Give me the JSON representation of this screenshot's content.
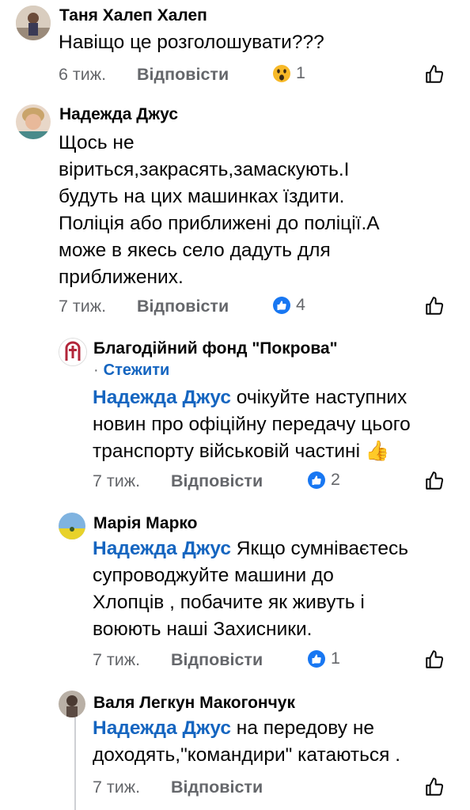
{
  "comments": [
    {
      "author": "Таня Халеп Халеп",
      "text": "Навіщо  це розголошувати???",
      "time": "6 тиж.",
      "reply_label": "Відповісти",
      "reaction_icon": "wow-icon",
      "reaction_count": "1"
    },
    {
      "author": "Надежда Джус",
      "text_lines": [
        "Щось не",
        "віриться,закрасять,замаскують.І",
        "будуть на цих машинках їздити.",
        "Поліція або приближені до поліції.А",
        "може в якесь село дадуть для",
        "приближених."
      ],
      "time": "7 тиж.",
      "reply_label": "Відповісти",
      "reaction_icon": "like-icon",
      "reaction_count": "4"
    }
  ],
  "replies": [
    {
      "author": "Благодійний фонд \"Покрова\"",
      "follow_label": "Стежити",
      "mention": "Надежда Джус",
      "line1_rest": " очікуйте наступних",
      "line2": "новин про офіційну передачу цього",
      "line3": "транспорту військовій частині",
      "emoji": "👍",
      "time": "7 тиж.",
      "reply_label": "Відповісти",
      "reaction_icon": "like-icon",
      "reaction_count": "2"
    },
    {
      "author": "Марія Марко",
      "mention": "Надежда Джус",
      "line1_rest": " Якщо  сумніваєтесь",
      "line2": "супроводжуйте  машини  до",
      "line3": "Хлопців , побачите  як  живуть і",
      "line4": "воюють  наші  Захисники.",
      "time": "7 тиж.",
      "reply_label": "Відповісти",
      "reaction_icon": "like-icon",
      "reaction_count": "1"
    },
    {
      "author": "Валя Легкун Макогончук",
      "mention": "Надежда Джус",
      "line1_rest": " на передову не",
      "line2": "доходять,\"командири\" катаються .",
      "time": "7 тиж.",
      "reply_label": "Відповісти"
    }
  ],
  "colors": {
    "link": "#1565c0",
    "meta": "#65676b",
    "like": "#1877f2"
  }
}
